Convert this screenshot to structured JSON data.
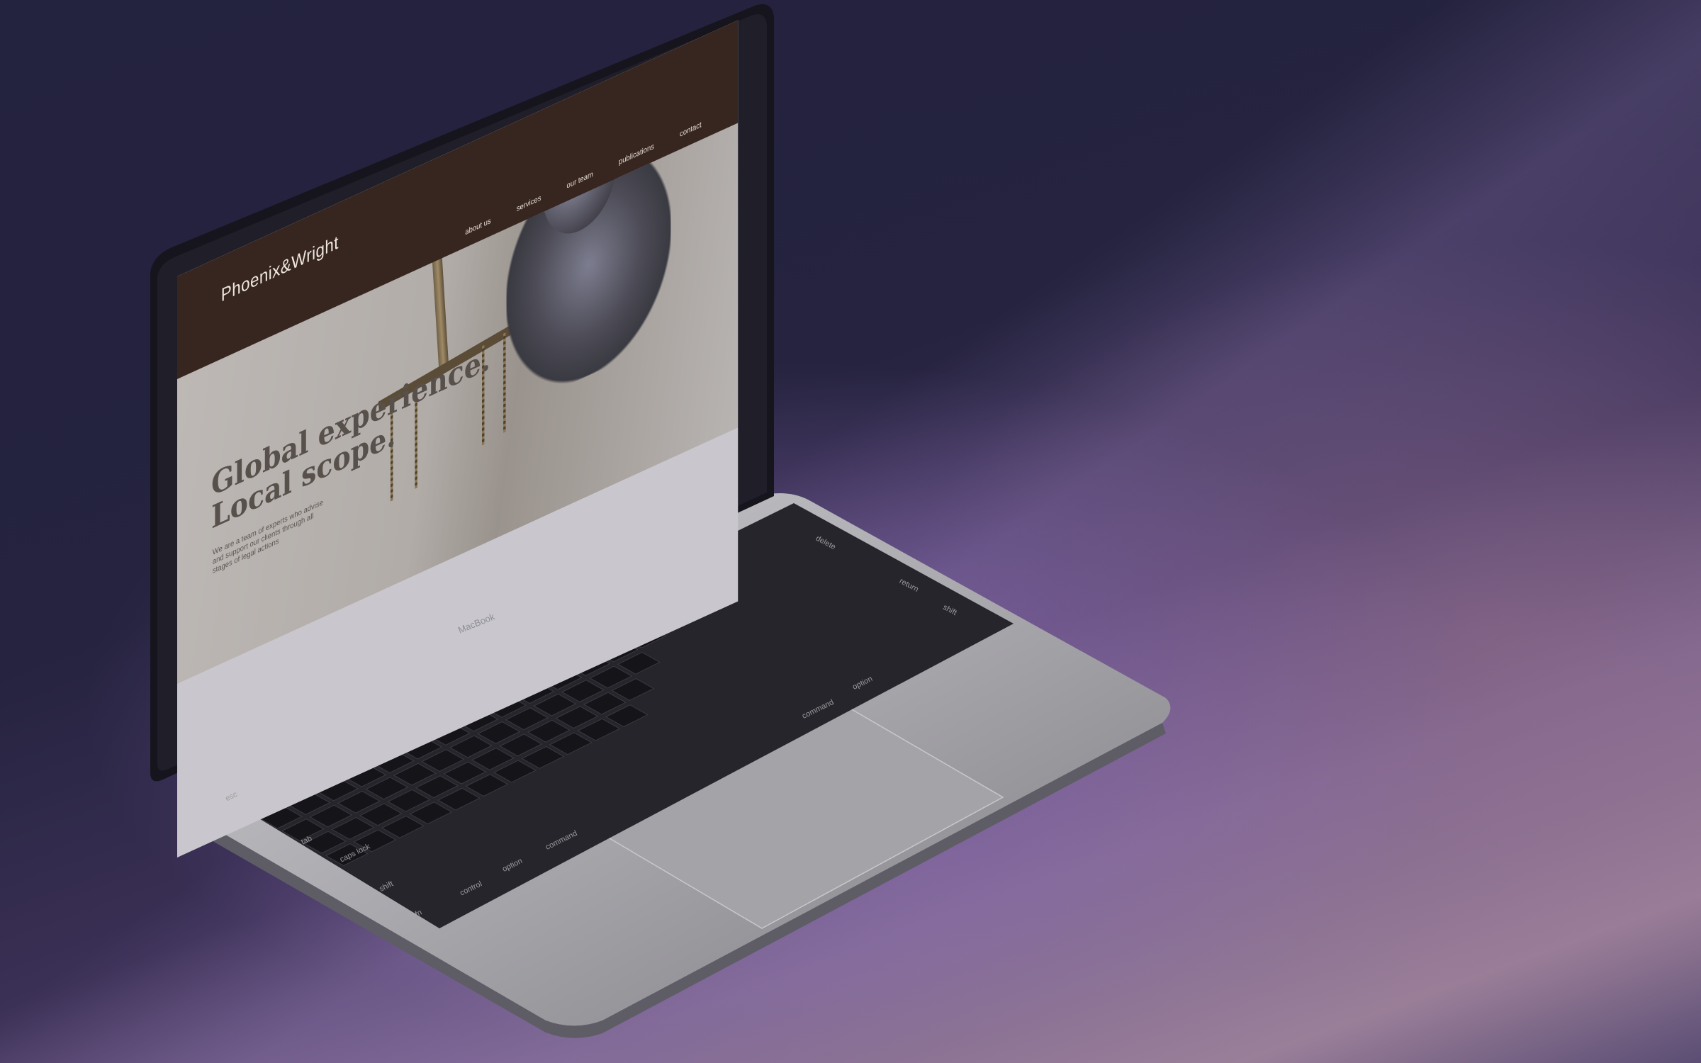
{
  "website": {
    "brand": "Phoenix&Wright",
    "nav": [
      "about us",
      "services",
      "our team",
      "publications",
      "contact"
    ],
    "hero_title_line1": "Global experience.",
    "hero_title_line2": "Local scope.",
    "hero_subtitle": "We are a team of experts who advise and support our clients through all stages of legal actions"
  },
  "device": {
    "model_label": "MacBook"
  },
  "keyboard": {
    "labels": [
      "esc",
      "tab",
      "caps lock",
      "shift",
      "fn",
      "control",
      "option",
      "command",
      "command",
      "option",
      "delete",
      "return",
      "shift"
    ]
  },
  "colors": {
    "header": "#37261f",
    "hero_text": "#57504b",
    "background_top": "#23223f",
    "background_floor": "#9a7f99"
  }
}
